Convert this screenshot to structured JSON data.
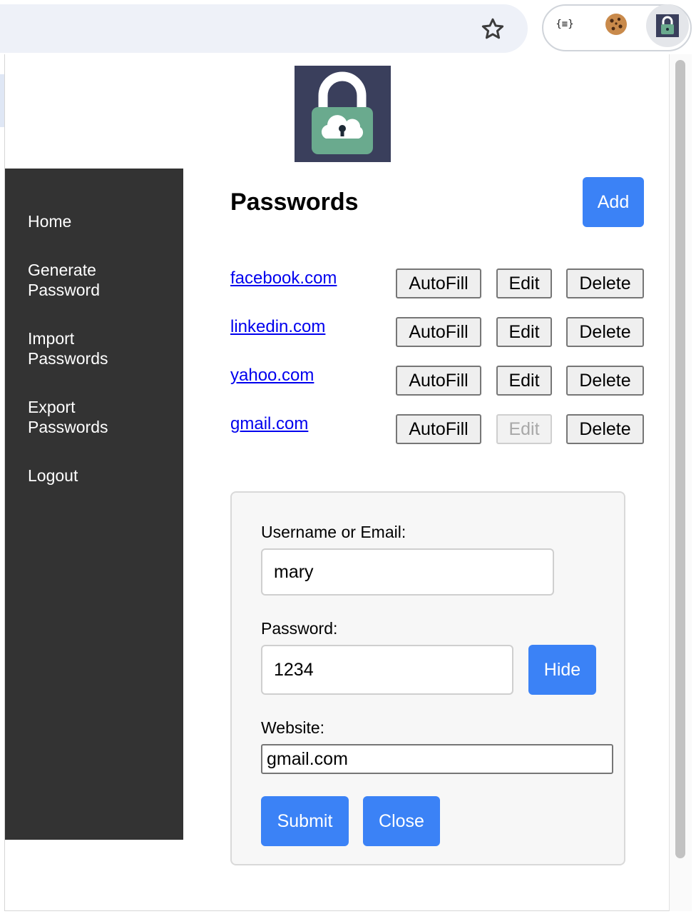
{
  "extensions": {
    "json_label": "{≡}"
  },
  "nav": {
    "items": [
      {
        "line1": "Home",
        "line2": ""
      },
      {
        "line1": "Generate",
        "line2": "Password"
      },
      {
        "line1": "Import",
        "line2": "Passwords"
      },
      {
        "line1": "Export",
        "line2": "Passwords"
      },
      {
        "line1": "Logout",
        "line2": ""
      }
    ]
  },
  "main": {
    "title": "Passwords",
    "add_label": "Add",
    "passwords": [
      {
        "site": "facebook.com",
        "autofill": "AutoFill",
        "edit": "Edit",
        "delete": "Delete",
        "edit_disabled": false
      },
      {
        "site": "linkedin.com",
        "autofill": "AutoFill",
        "edit": "Edit",
        "delete": "Delete",
        "edit_disabled": false
      },
      {
        "site": "yahoo.com",
        "autofill": "AutoFill",
        "edit": "Edit",
        "delete": "Delete",
        "edit_disabled": false
      },
      {
        "site": "gmail.com",
        "autofill": "AutoFill",
        "edit": "Edit",
        "delete": "Delete",
        "edit_disabled": true
      }
    ]
  },
  "form": {
    "username_label": "Username or Email:",
    "username_value": "mary",
    "password_label": "Password:",
    "password_value": "1234",
    "hide_label": "Hide",
    "website_label": "Website:",
    "website_value": "gmail.com",
    "submit_label": "Submit",
    "close_label": "Close"
  },
  "colors": {
    "sidebar": "#333333",
    "primary_button": "#3b82f6",
    "link": "#0000ee",
    "logo_bg": "#3a3f5c",
    "lock_body": "#6aaa8e"
  }
}
